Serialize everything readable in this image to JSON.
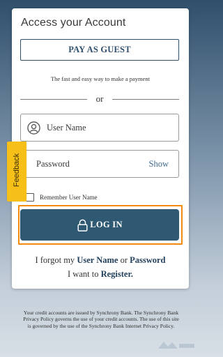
{
  "login_card": {
    "title": "Access your Account",
    "guest_button_label": "PAY AS GUEST",
    "guest_subtitle": "The fast and easy way to make a payment",
    "divider_label": "or",
    "username": {
      "placeholder": "User Name",
      "value": ""
    },
    "password": {
      "placeholder": "Password",
      "value": "",
      "show_label": "Show"
    },
    "remember_label": "Remember User Name",
    "remember_checked": false,
    "login_button_label": "LOG IN",
    "forgot": {
      "prefix": "I forgot my ",
      "username_link": "User Name",
      "middle": " or ",
      "password_link": "Password"
    },
    "register": {
      "prefix": "I want to ",
      "link": "Register."
    }
  },
  "feedback_tab": {
    "label": "Feedback"
  },
  "footer_text": "Your credit accounts are issued by Synchrony Bank. The Synchrony Bank Privacy Policy governs the use of your credit accounts. The use of this site is governed by the use of the Synchrony Bank Internet Privacy Policy.",
  "icons": {
    "user": "user-circle-icon",
    "lock": "lock-icon",
    "watermark": "watermark-logo"
  },
  "colors": {
    "primary": "#2f5872",
    "highlight_border": "#f28b10",
    "feedback": "#f6c018",
    "link": "#23405c"
  }
}
